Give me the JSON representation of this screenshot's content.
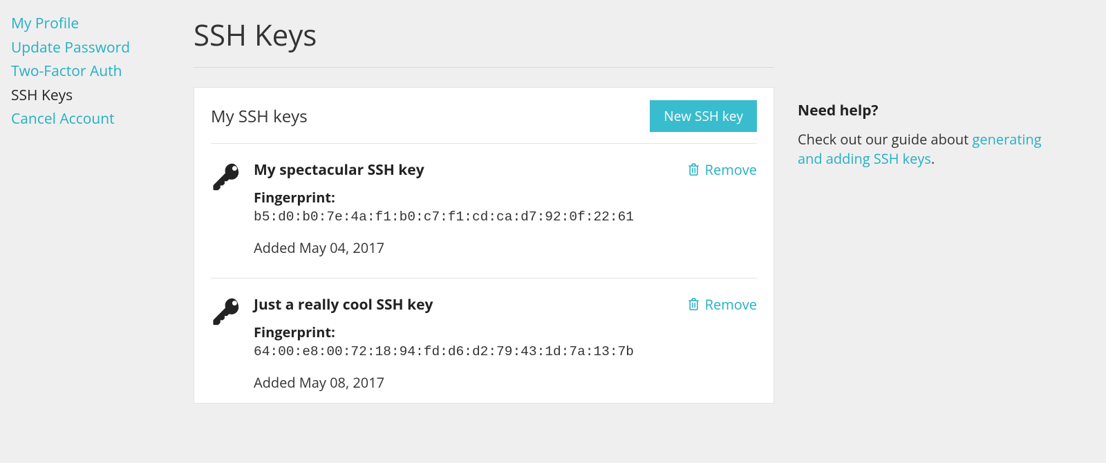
{
  "sidebar": {
    "items": [
      {
        "label": "My Profile",
        "active": false
      },
      {
        "label": "Update Password",
        "active": false
      },
      {
        "label": "Two-Factor Auth",
        "active": false
      },
      {
        "label": "SSH Keys",
        "active": true
      },
      {
        "label": "Cancel Account",
        "active": false
      }
    ]
  },
  "page": {
    "title": "SSH Keys"
  },
  "panel": {
    "title": "My SSH keys",
    "new_button": "New SSH key"
  },
  "fingerprint_label": "Fingerprint:",
  "added_prefix": "Added ",
  "remove_label": "Remove",
  "keys": [
    {
      "name": "My spectacular SSH key",
      "fingerprint": "b5:d0:b0:7e:4a:f1:b0:c7:f1:cd:ca:d7:92:0f:22:61",
      "added": "May 04, 2017"
    },
    {
      "name": "Just a really cool SSH key",
      "fingerprint": "64:00:e8:00:72:18:94:fd:d6:d2:79:43:1d:7a:13:7b",
      "added": "May 08, 2017"
    }
  ],
  "help": {
    "title": "Need help?",
    "prefix": "Check out our guide about ",
    "link_text": "generating and adding SSH keys",
    "suffix": "."
  }
}
